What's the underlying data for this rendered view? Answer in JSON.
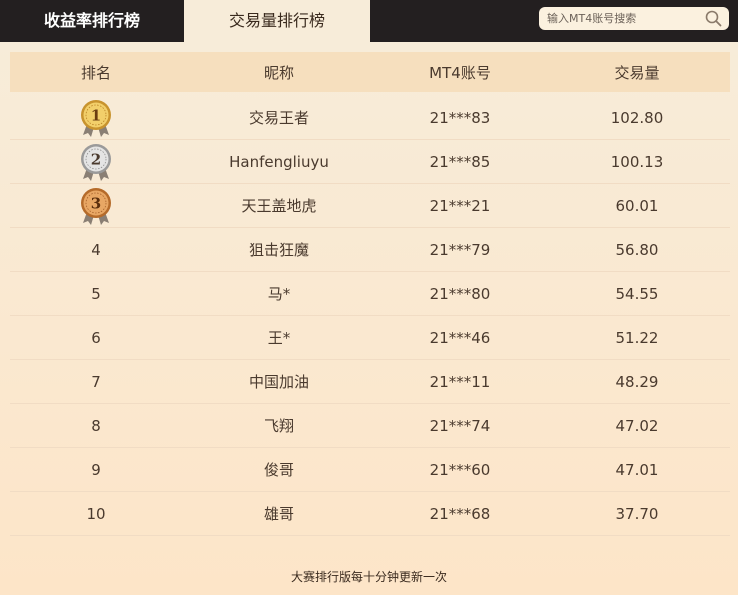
{
  "tabs": [
    {
      "label": "收益率排行榜",
      "active": false
    },
    {
      "label": "交易量排行榜",
      "active": true
    }
  ],
  "search": {
    "placeholder": "输入MT4账号搜索",
    "icon": "search-icon"
  },
  "table": {
    "headers": [
      "排名",
      "昵称",
      "MT4账号",
      "交易量"
    ],
    "rows": [
      {
        "rank": "1",
        "medal": "gold",
        "name": "交易王者",
        "account": "21***83",
        "volume": "102.80"
      },
      {
        "rank": "2",
        "medal": "silver",
        "name": "Hanfengliuyu",
        "account": "21***85",
        "volume": "100.13"
      },
      {
        "rank": "3",
        "medal": "bronze",
        "name": "天王盖地虎",
        "account": "21***21",
        "volume": "60.01"
      },
      {
        "rank": "4",
        "name": "狙击狂魔",
        "account": "21***79",
        "volume": "56.80"
      },
      {
        "rank": "5",
        "name": "马*",
        "account": "21***80",
        "volume": "54.55"
      },
      {
        "rank": "6",
        "name": "王*",
        "account": "21***46",
        "volume": "51.22"
      },
      {
        "rank": "7",
        "name": "中国加油",
        "account": "21***11",
        "volume": "48.29"
      },
      {
        "rank": "8",
        "name": "飞翔",
        "account": "21***74",
        "volume": "47.02"
      },
      {
        "rank": "9",
        "name": "俊哥",
        "account": "21***60",
        "volume": "47.01"
      },
      {
        "rank": "10",
        "name": "雄哥",
        "account": "21***68",
        "volume": "37.70"
      }
    ]
  },
  "footer": {
    "note": "大赛排行版每十分钟更新一次"
  },
  "colors": {
    "topbar": "#231f20",
    "panel_top": "#f7ecd9",
    "panel_bottom": "#fde5c8",
    "header_row": "#f6dfbe",
    "text": "#4a3a2e",
    "gold": "#e8b845",
    "silver": "#c9c9c9",
    "bronze": "#d99a52"
  }
}
